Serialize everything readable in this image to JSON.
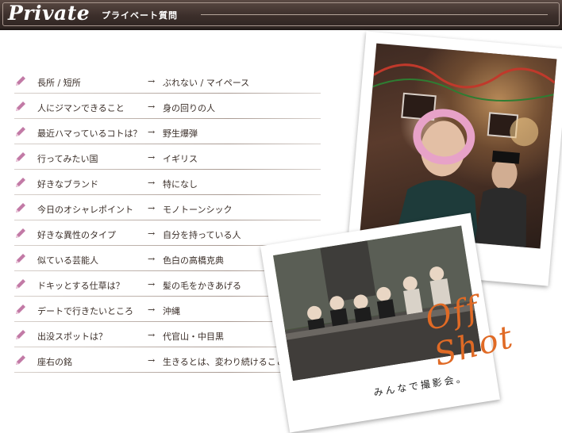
{
  "header": {
    "title": "Private",
    "subtitle": "プライベート質問"
  },
  "qa": [
    {
      "q": "長所 / 短所",
      "a": "ぶれない / マイペース"
    },
    {
      "q": "人にジマンできること",
      "a": "身の回りの人"
    },
    {
      "q": "最近ハマっているコトは？",
      "a": "野生爆弾"
    },
    {
      "q": "行ってみたい国",
      "a": "イギリス"
    },
    {
      "q": "好きなブランド",
      "a": "特になし"
    },
    {
      "q": "今日のオシャレポイント",
      "a": "モノトーンシック"
    },
    {
      "q": "好きな異性のタイプ",
      "a": "自分を持っている人"
    },
    {
      "q": "似ている芸能人",
      "a": "色白の高橋克典"
    },
    {
      "q": "ドキッとする仕草は？",
      "a": "髪の毛をかきあげる"
    },
    {
      "q": "デートで行きたいところ",
      "a": "沖縄"
    },
    {
      "q": "出没スポットは？",
      "a": "代官山・中目黒"
    },
    {
      "q": "座右の銘",
      "a": "生きるとは、変わり続けること"
    }
  ],
  "arrow_glyph": "→",
  "photos": {
    "caption": "みんなで撮影会。",
    "overlay_text": "Off Shot"
  },
  "colors": {
    "header_bg": "#3c2f2b",
    "pencil": "#c27aa6",
    "offshot": "#e06a25"
  },
  "icons": {
    "row_icon": "pencil-icon"
  }
}
